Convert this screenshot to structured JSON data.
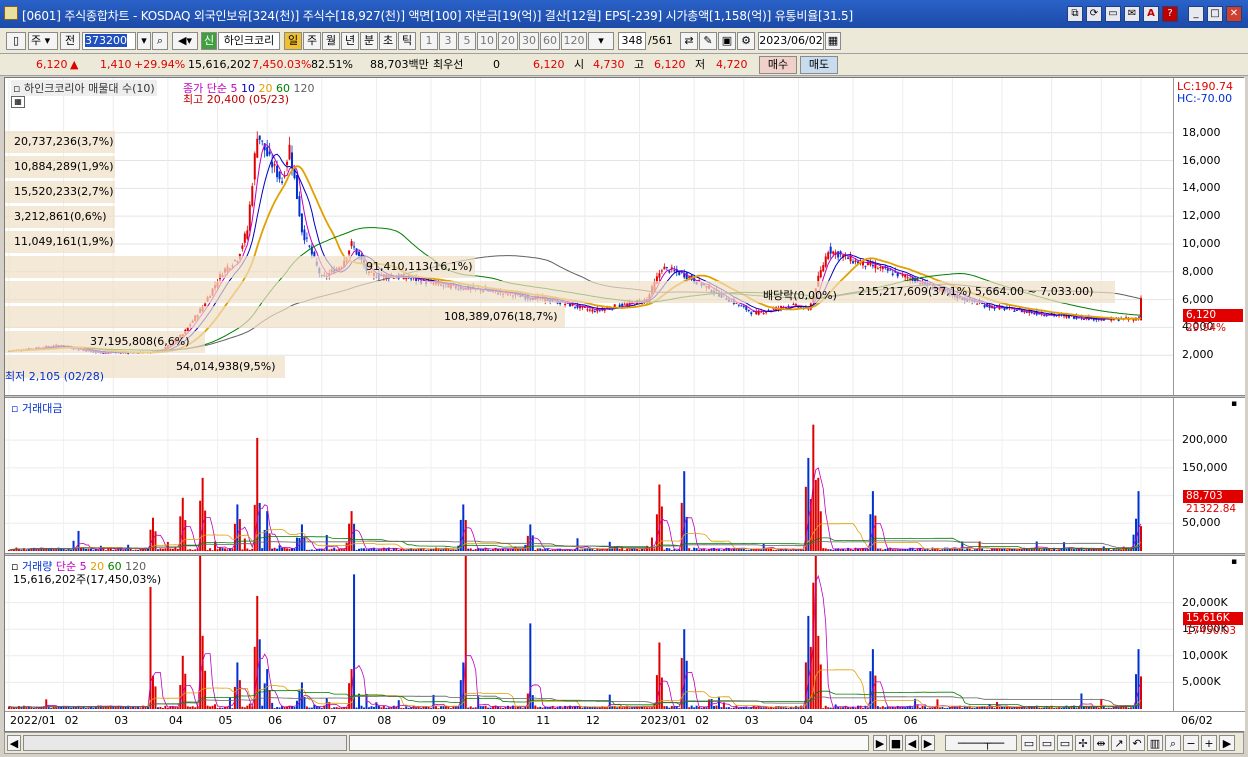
{
  "window": {
    "title": "[0601] 주식종합차트 - KOSDAQ 외국인보유[324(천)] 주식수[18,927(천)] 액면[100] 자본금[19(억)] 결산[12월] EPS[-239] 시가총액[1,158(억)] 유통비율[31.5]",
    "buttons": [
      "⧉",
      "⟳",
      "▭",
      "✉",
      "A",
      "?",
      "_",
      "□",
      "✕"
    ]
  },
  "toolbar": {
    "market_label": "주",
    "prev_label": "전",
    "code": "373200",
    "stock_name": "하인크코리",
    "new_badge": "신",
    "periods": [
      "일",
      "주",
      "월",
      "년",
      "분",
      "초",
      "틱"
    ],
    "intervals": [
      "1",
      "3",
      "5",
      "10",
      "20",
      "30",
      "60",
      "120"
    ],
    "count": "348",
    "count_total": "/561",
    "date": "2023/06/02"
  },
  "quote": {
    "price": "6,120",
    "change": "1,410",
    "change_pct": "+29.94%",
    "volume": "15,616,202",
    "volume_pct": "7,450.03%",
    "ratio": "82.51%",
    "amount": "88,703백만",
    "best_label": "최우선",
    "best_value": "0",
    "best_price": "6,120",
    "open_label": "시",
    "open": "4,730",
    "high_label": "고",
    "high": "6,120",
    "low_label": "저",
    "low": "4,720",
    "buy_label": "매수",
    "sell_label": "매도"
  },
  "price_pane": {
    "title": "하인크코리아 매물대 수(10)",
    "ma_label": "종가 단순",
    "ma_periods": [
      "5",
      "10",
      "20",
      "60",
      "120"
    ],
    "high_note": "최고 20,400 (05/23)",
    "low_note": "최저 2,105 (02/28)",
    "lc": "LC:190.74",
    "hc": "HC:-70.00",
    "last_price": "6,120",
    "last_pct": "29.94%",
    "event_note": "배당락(0,00%)",
    "range_note": "215,217,609(37,1%) 5,664.00 ~ 7,033.00)",
    "y_ticks": [
      "18,000",
      "16,000",
      "14,000",
      "12,000",
      "10,000",
      "8,000",
      "6,000",
      "4,000",
      "2,000"
    ],
    "volume_profile": [
      {
        "label": "20,737,236(3,7%)",
        "value": 3.7
      },
      {
        "label": "10,884,289(1,9%)",
        "value": 1.9
      },
      {
        "label": "15,520,233(2,7%)",
        "value": 2.7
      },
      {
        "label": "3,212,861(0,6%)",
        "value": 0.6
      },
      {
        "label": "11,049,161(1,9%)",
        "value": 1.9
      },
      {
        "label": "91,410,113(16,1%)",
        "value": 16.1
      },
      {
        "label": "215,217,609(37,1%)",
        "value": 37.1
      },
      {
        "label": "108,389,076(18,7%)",
        "value": 18.7
      },
      {
        "label": "37,195,808(6,6%)",
        "value": 6.6
      },
      {
        "label": "54,014,938(9,5%)",
        "value": 9.5
      }
    ]
  },
  "amount_pane": {
    "title": "거래대금",
    "y_ticks": [
      "200,000",
      "150,000",
      "100,000",
      "50,000"
    ],
    "last_value": "88,703",
    "last_ma": "21322.84"
  },
  "volume_pane": {
    "title": "거래량",
    "ma_label": "단순",
    "ma_periods": [
      "5",
      "20",
      "60",
      "120"
    ],
    "info": "15,616,202주(17,450,03%)",
    "y_ticks": [
      "20,000K",
      "15,000K",
      "10,000K",
      "5,000K"
    ],
    "last_value": "15,616K",
    "last_ma": "17450.03"
  },
  "x_axis": [
    "2022/01",
    "02",
    "03",
    "04",
    "05",
    "06",
    "07",
    "08",
    "09",
    "10",
    "11",
    "12",
    "2023/01",
    "02",
    "03",
    "04",
    "05",
    "06",
    "06/02"
  ],
  "colors": {
    "up": "#e00000",
    "down": "#0030d0",
    "ma5": "#c000c0",
    "ma10": "#0000c0",
    "ma20": "#e0a000",
    "ma60": "#008000",
    "ma120": "#606060"
  }
}
